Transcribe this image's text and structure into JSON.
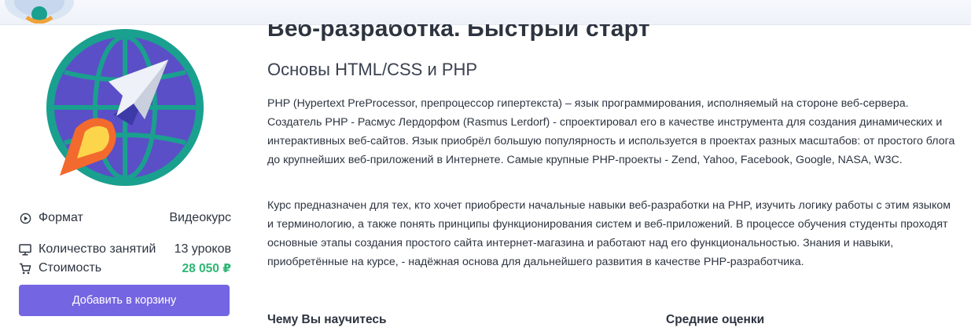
{
  "course": {
    "title": "Веб-разработка. Быстрый старт",
    "subtitle": "Основы HTML/CSS и PHP",
    "description": [
      "PHP (Hypertext PreProcessor, препроцессор гипертекста) – язык программирования, исполняемый на стороне веб-сервера. Создатель PHP - Расмус Лердорфом (Rasmus Lerdorf) - спроектировал его в качестве инструмента для создания динамических и интерактивных веб-сайтов. Язык приобрёл большую популярность и используется в проектах разных масштабов: от простого блога до крупнейших веб-приложений в Интернете. Самые крупные PHP-проекты - Zend, Yahoo, Facebook, Google, NASA, W3C.",
      "Курс предназначен для тех, кто хочет приобрести начальные навыки веб-разработки на PHP, изучить логику работы с этим языком и терминологию, а также понять принципы функционирования систем и веб-приложений. В процессе обучения студенты проходят основные этапы создания простого сайта интернет-магазина и работают над его функциональностью. Знания и навыки, приобретённые на курсе, - надёжная основа для дальнейшего развития в качестве PHP-разработчика."
    ]
  },
  "meta": {
    "format": {
      "label": "Формат",
      "value": "Видеокурс",
      "icon": "play-circle-icon"
    },
    "lessons": {
      "label": "Количество занятий",
      "value": "13 уроков",
      "icon": "monitor-icon"
    },
    "price": {
      "label": "Стоимость",
      "value": "28 050 ₽",
      "icon": "cart-icon"
    }
  },
  "actions": {
    "add_to_cart": "Добавить в корзину"
  },
  "sections": {
    "learn": "Чему Вы научитесь",
    "ratings": "Средние оценки"
  },
  "colors": {
    "accent_button": "#7465e2",
    "price_green": "#2bb673",
    "logo_teal": "#1aa08e",
    "logo_purple": "#5a4fc7",
    "flame_orange": "#f26a2e",
    "flame_yellow": "#fcd54a"
  }
}
